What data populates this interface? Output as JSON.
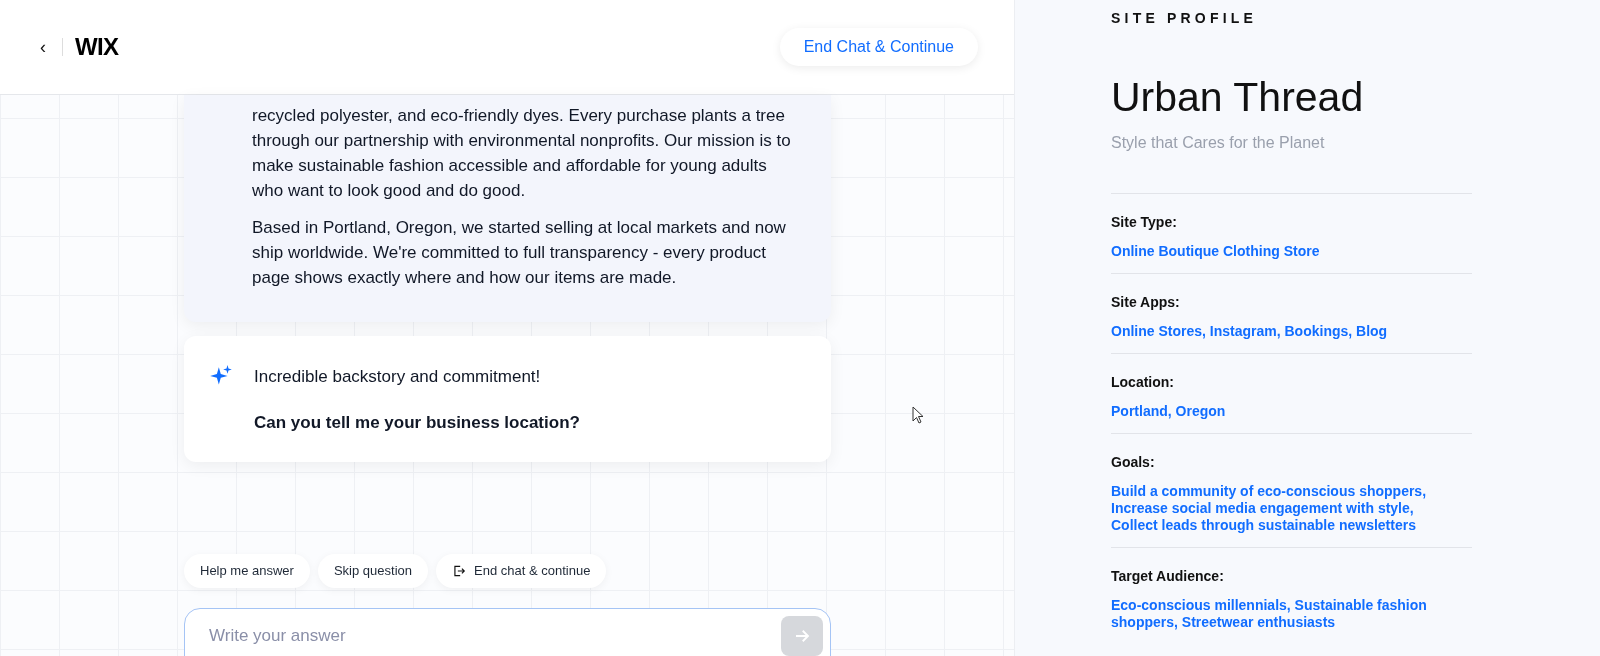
{
  "header": {
    "back_label": "‹",
    "logo": "WIX",
    "end_button": "End Chat & Continue"
  },
  "chat": {
    "messages": [
      {
        "kind": "user",
        "paragraphs": [
          "recycled polyester, and eco-friendly dyes. Every purchase plants a tree through our partnership with environmental nonprofits. Our mission is to make sustainable fashion accessible and affordable for young adults who want to look good and do good.",
          "Based in Portland, Oregon, we started selling at local markets and now ship worldwide. We're committed to full transparency - every product page shows exactly where and how our items are made."
        ]
      },
      {
        "kind": "assistant",
        "paragraphs": [
          "Incredible backstory and commitment!",
          "Can you tell me your business location?"
        ]
      }
    ],
    "chips": [
      {
        "label": "Help me answer",
        "kind": "plain"
      },
      {
        "label": "Skip question",
        "kind": "plain"
      },
      {
        "label": "End chat & continue",
        "kind": "exit"
      }
    ],
    "input": {
      "placeholder": "Write your answer"
    }
  },
  "profile": {
    "heading": "SITE PROFILE",
    "name": "Urban Thread",
    "tagline": "Style that Cares for the Planet",
    "fields": [
      {
        "label": "Site Type:",
        "value": "Online Boutique Clothing Store"
      },
      {
        "label": "Site Apps:",
        "value": "Online Stores, Instagram, Bookings, Blog"
      },
      {
        "label": "Location:",
        "value": "Portland, Oregon"
      },
      {
        "label": "Goals:",
        "value": "Build a community of eco-conscious shoppers, Increase social media engagement with style, Collect leads through sustainable newsletters"
      },
      {
        "label": "Target Audience:",
        "value": "Eco-conscious millennials, Sustainable fashion shoppers, Streetwear enthusiasts"
      }
    ]
  }
}
